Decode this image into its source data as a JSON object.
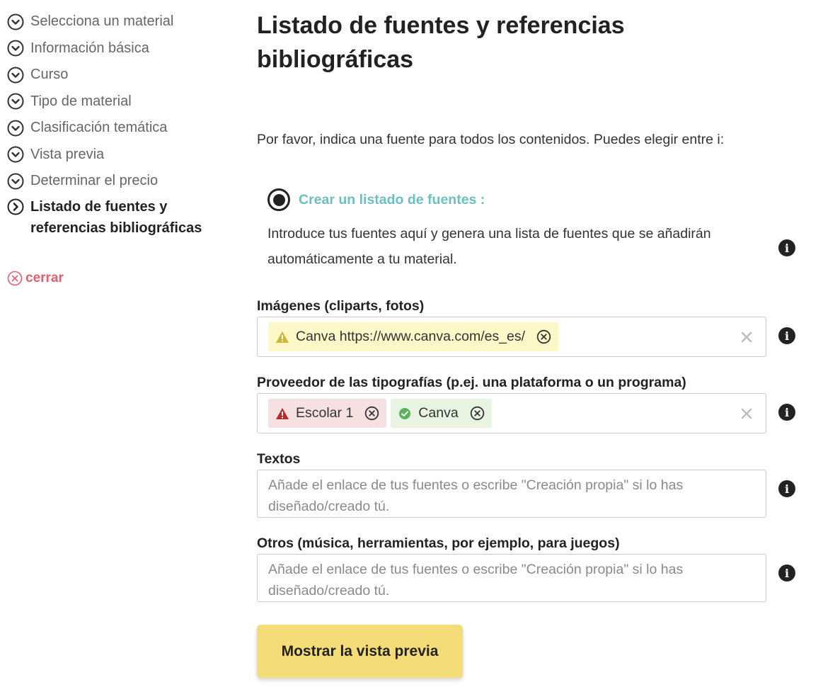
{
  "sidebar": {
    "steps": [
      {
        "label": "Selecciona un material"
      },
      {
        "label": "Información básica"
      },
      {
        "label": "Curso"
      },
      {
        "label": "Tipo de material"
      },
      {
        "label": "Clasificación temática"
      },
      {
        "label": "Vista previa"
      },
      {
        "label": "Determinar el precio"
      },
      {
        "label": "Listado de fuentes y referencias bibliográficas"
      }
    ],
    "close_label": "cerrar"
  },
  "main": {
    "title": "Listado de fuentes y referencias bibliográficas",
    "intro": "Por favor, indica una fuente para todos los contenidos. Puedes elegir entre i:",
    "option": {
      "label": "Crear un listado de fuentes :",
      "description": "Introduce tus fuentes aquí y genera una lista de fuentes que se añadirán automáticamente a tu material."
    },
    "fields": {
      "images": {
        "label": "Imágenes (cliparts, fotos)",
        "tags": [
          {
            "text": "Canva https://www.canva.com/es_es/",
            "status": "warning"
          }
        ]
      },
      "fonts": {
        "label": "Proveedor de las tipografías (p.ej. una plataforma o un programa)",
        "tags": [
          {
            "text": "Escolar 1",
            "status": "error"
          },
          {
            "text": "Canva",
            "status": "ok"
          }
        ]
      },
      "texts": {
        "label": "Textos",
        "value": "",
        "placeholder": "Añade el enlace de tus fuentes o escribe \"Creación propia\" si lo has diseñado/creado tú."
      },
      "others": {
        "label": "Otros (música, herramientas, por ejemplo, para juegos)",
        "value": "",
        "placeholder": "Añade el enlace de tus fuentes o escribe \"Creación propia\" si lo has diseñado/creado tú."
      }
    },
    "preview_button": "Mostrar la vista previa"
  },
  "colors": {
    "accent_teal": "#6cbfc0",
    "close_red": "#e0606c",
    "button_yellow": "#f4dc78",
    "tag_warning_bg": "#fcf8c8",
    "tag_error_bg": "#f6e0e2",
    "tag_ok_bg": "#e8f3e2"
  },
  "icons": {
    "step": "chevron-down-circle-icon",
    "active_step": "chevron-right-circle-icon",
    "close": "close-circle-icon",
    "info": "info-icon",
    "warning": "warning-icon",
    "error": "error-icon",
    "ok": "check-circle-icon",
    "tag_remove": "close-circle-icon",
    "clear": "clear-x-icon"
  }
}
